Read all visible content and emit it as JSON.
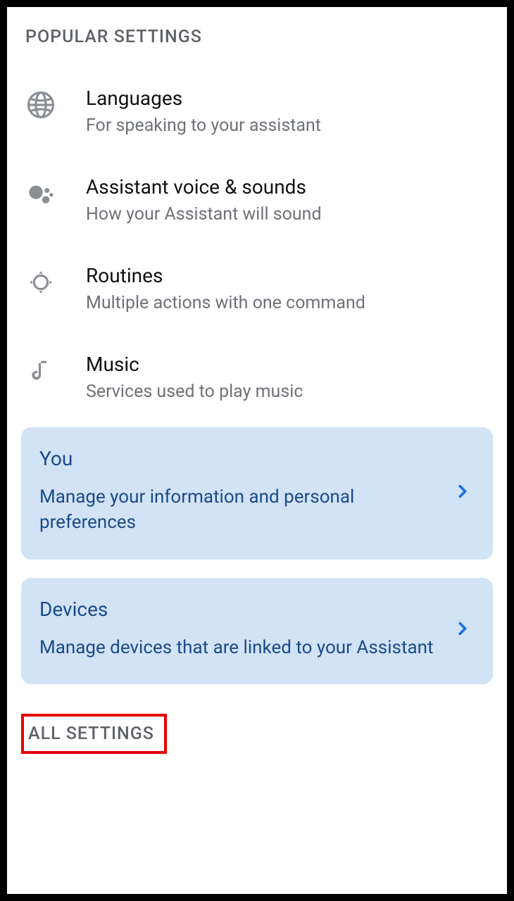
{
  "sections": {
    "popular": {
      "header": "POPULAR SETTINGS",
      "items": [
        {
          "title": "Languages",
          "subtitle": "For speaking to your assistant"
        },
        {
          "title": "Assistant voice & sounds",
          "subtitle": "How your Assistant will sound"
        },
        {
          "title": "Routines",
          "subtitle": "Multiple actions with one command"
        },
        {
          "title": "Music",
          "subtitle": "Services used to play music"
        }
      ]
    },
    "all": {
      "header": "ALL SETTINGS"
    }
  },
  "cards": [
    {
      "title": "You",
      "subtitle": "Manage your information and personal preferences"
    },
    {
      "title": "Devices",
      "subtitle": "Manage devices that are linked to your Assistant"
    }
  ]
}
